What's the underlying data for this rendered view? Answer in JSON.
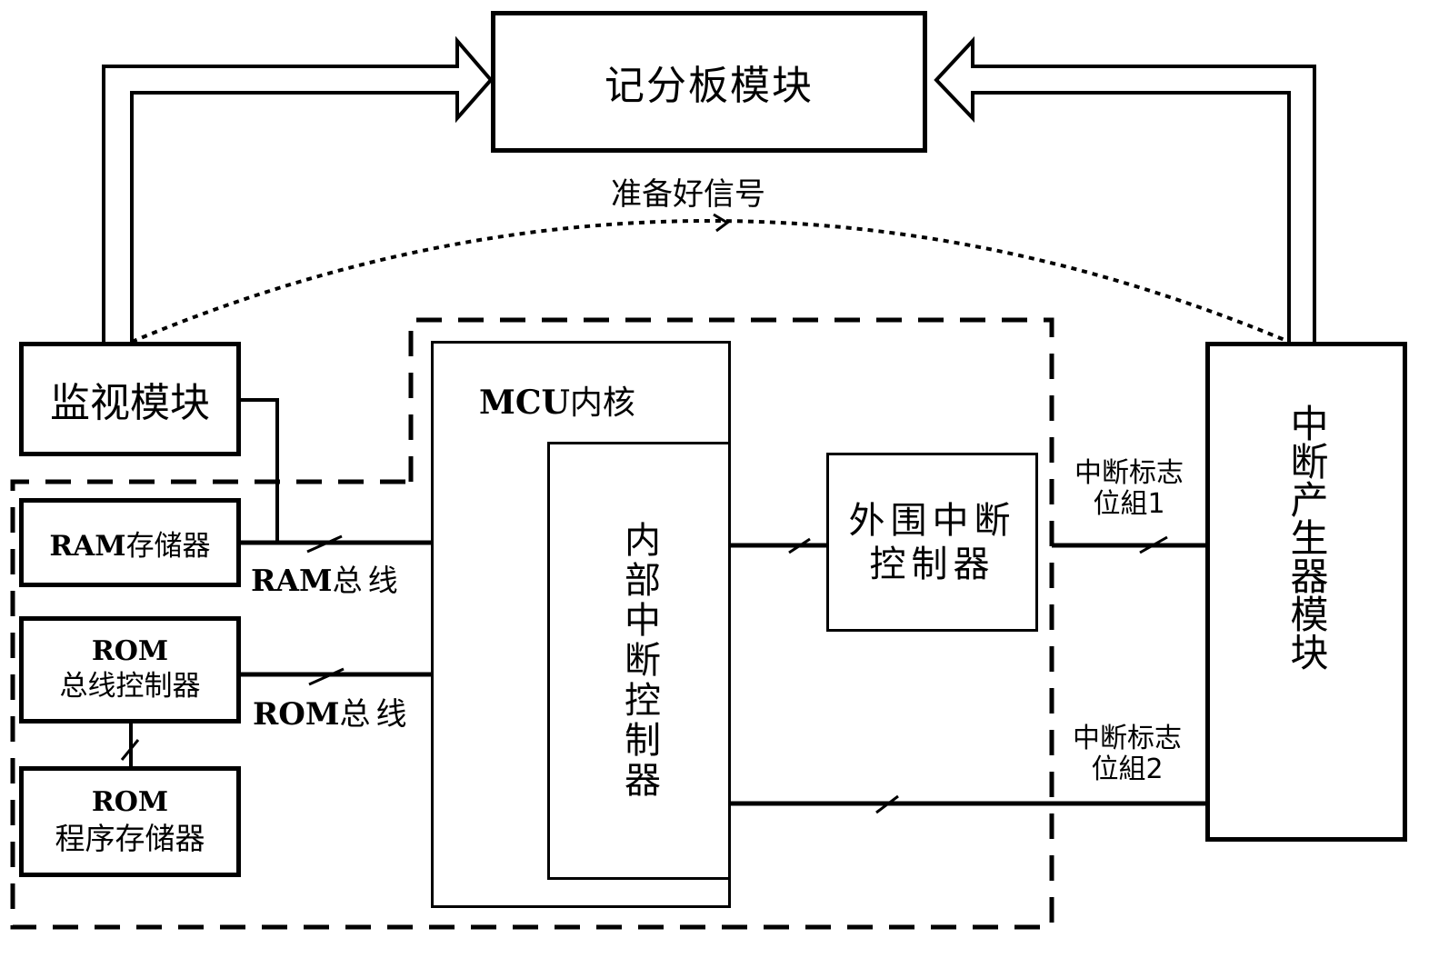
{
  "diagram": {
    "scoreboard": {
      "label": "记分板模块"
    },
    "ready_signal": {
      "label": "准备好信号"
    },
    "monitor": {
      "label": "监视模块"
    },
    "ram_storage": {
      "prefix": "RAM",
      "label": "存储器"
    },
    "ram_bus": {
      "prefix": "RAM",
      "label": "总线"
    },
    "rom_bus_controller": {
      "line1": "ROM",
      "line2": "总线控制器"
    },
    "rom_bus": {
      "prefix": "ROM",
      "label": "总线"
    },
    "rom_program_storage": {
      "line1": "ROM",
      "line2": "程序存储器"
    },
    "mcu_core": {
      "prefix": "MCU",
      "label": "内核"
    },
    "internal_interrupt_controller": {
      "label": "内部中断控制器"
    },
    "peripheral_interrupt_controller": {
      "line1": "外围中断",
      "line2": "控制器"
    },
    "flag_group_1": {
      "line1": "中断标志",
      "line2": "位組1"
    },
    "flag_group_2": {
      "line1": "中断标志",
      "line2": "位組2"
    },
    "interrupt_generator": {
      "label": "中断产生器模块"
    }
  }
}
